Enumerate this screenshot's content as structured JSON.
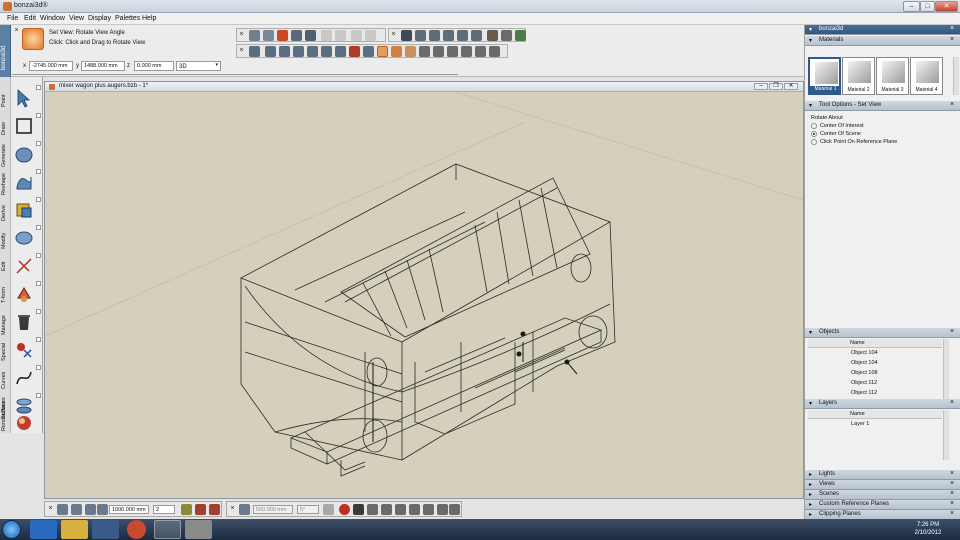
{
  "app": {
    "title": "bonzai3d®"
  },
  "menu": [
    "File",
    "Edit",
    "Window",
    "View",
    "Display",
    "Palettes",
    "Help"
  ],
  "vertical_tab": "bonzai3d",
  "setview": {
    "line1": "Set View:   Rotate View Angle",
    "line2": "Click: Click and Drag to Rotate View"
  },
  "coords": {
    "x_label": "x",
    "x_value": "-2745.000 mm",
    "y_label": "y",
    "y_value": "1488.000 mm",
    "z_label": "z",
    "z_value": "0.000 mm",
    "mode": "3D"
  },
  "tool_palette": [
    "Point",
    "Draw",
    "Generate",
    "Reshape",
    "Derive",
    "Modify",
    "Edit",
    "T-form",
    "Manage",
    "Special",
    "Curves",
    "Surfaces",
    "RenderZone"
  ],
  "document": {
    "title": "mixer wagon plus augers.bzb - 1*"
  },
  "bottom_left": {
    "distance": "1000.000 mm",
    "count": "2"
  },
  "bottom_right": {
    "distance": "500.000 mm",
    "angle": "5°"
  },
  "right_panel": {
    "title": "bonzai3d",
    "materials": {
      "header": "Materials",
      "items": [
        "Material 1",
        "Material 2",
        "Material 3",
        "Material 4"
      ]
    },
    "tool_options": {
      "header": "Tool Options - Set View",
      "rotate_label": "Rotate About",
      "options": [
        "Center Of Interest",
        "Center Of Scene",
        "Click Point On Reference Plane"
      ],
      "selected_index": 1
    },
    "objects": {
      "header": "Objects",
      "column": "Name",
      "rows": [
        "Object 104",
        "Object 104",
        "Object 108",
        "Object 112",
        "Object 112"
      ]
    },
    "layers": {
      "header": "Layers",
      "column": "Name",
      "rows": [
        "Layer 1"
      ]
    },
    "collapsed": [
      "Lights",
      "Views",
      "Scenes",
      "Custom Reference Planes",
      "Clipping Planes"
    ]
  },
  "taskbar": {
    "time": "7:26 PM",
    "date": "2/10/2012"
  }
}
